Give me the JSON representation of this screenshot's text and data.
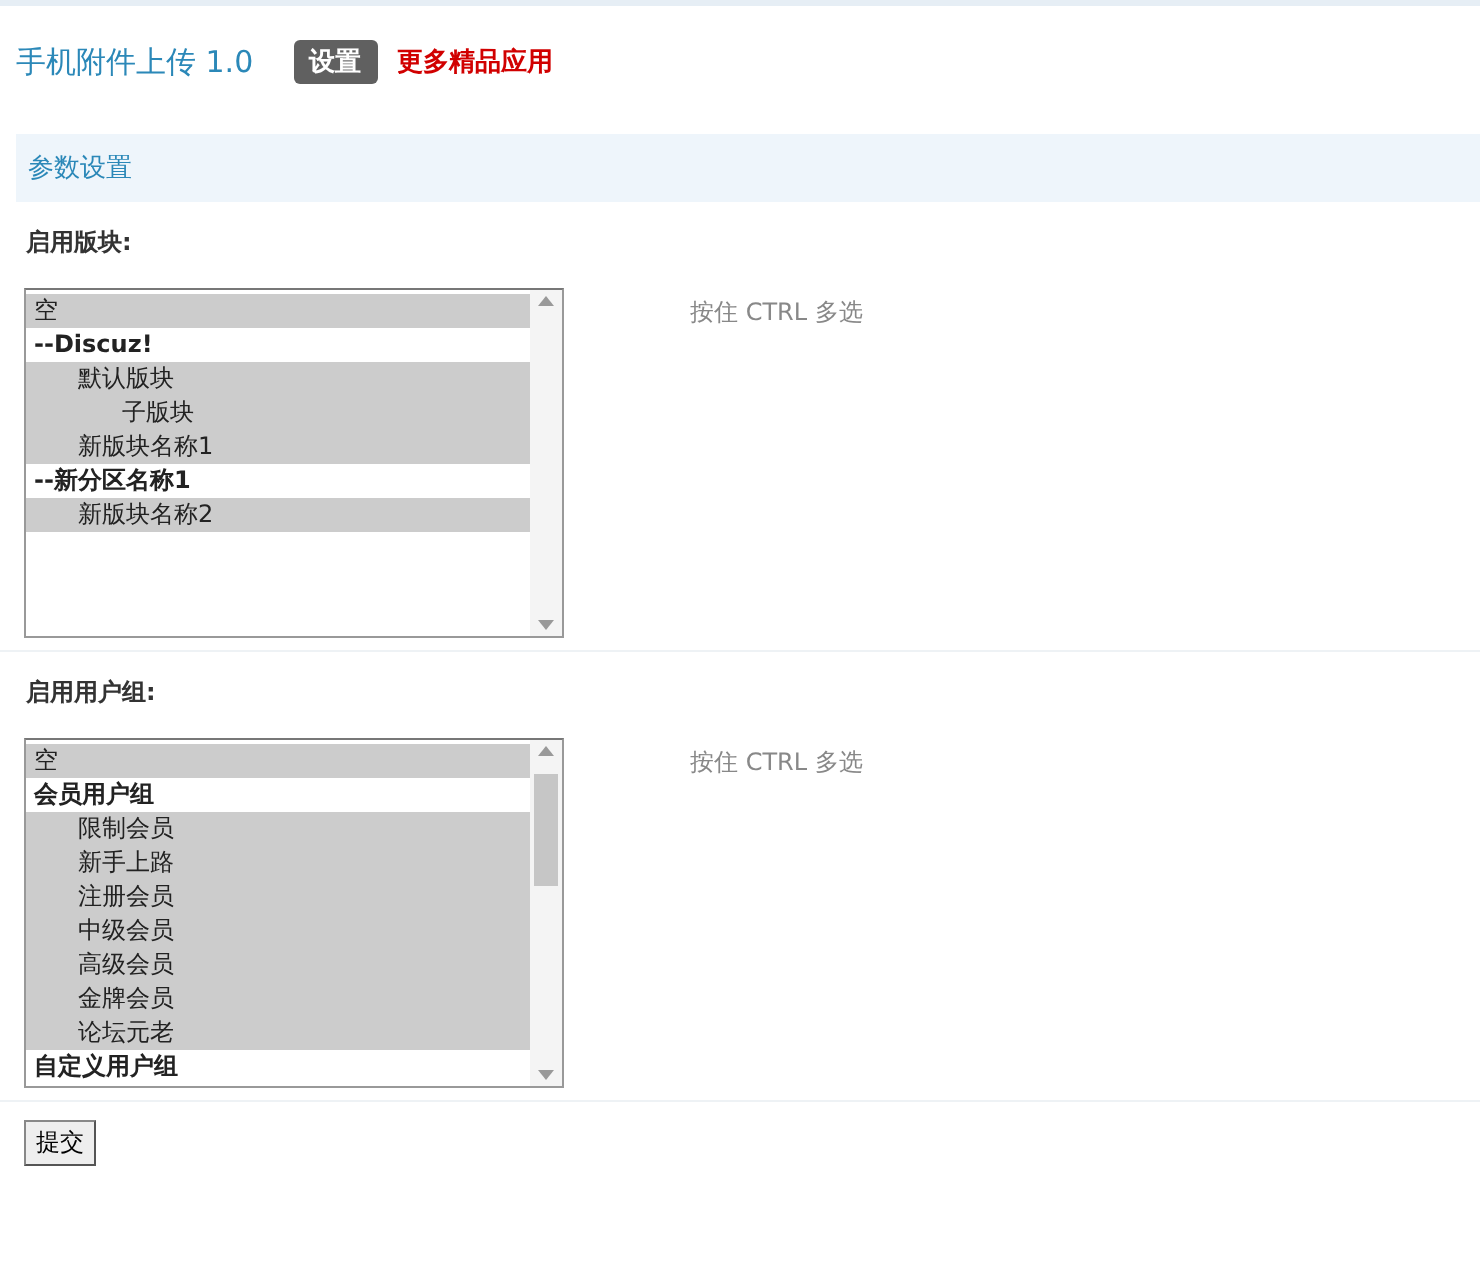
{
  "header": {
    "title": "手机附件上传 1.0",
    "tab": {
      "label": "设置",
      "selected": true
    },
    "link": "更多精品应用"
  },
  "section": {
    "title": "参数设置"
  },
  "fields": [
    {
      "label": "启用版块:",
      "hint": "按住 CTRL 多选",
      "options": [
        {
          "kind": "option",
          "label": "空",
          "selected": true
        },
        {
          "kind": "group",
          "label": "--Discuz!",
          "children": [
            {
              "kind": "option",
              "label": "默认版块",
              "selected": true,
              "children": [
                {
                  "kind": "option",
                  "label": "子版块",
                  "selected": true
                }
              ]
            },
            {
              "kind": "option",
              "label": "新版块名称1",
              "selected": true
            }
          ]
        },
        {
          "kind": "group",
          "label": "--新分区名称1",
          "children": [
            {
              "kind": "option",
              "label": "新版块名称2",
              "selected": true
            }
          ]
        }
      ]
    },
    {
      "label": "启用用户组:",
      "hint": "按住 CTRL 多选",
      "options": [
        {
          "kind": "option",
          "label": "空",
          "selected": true
        },
        {
          "kind": "group",
          "label": "会员用户组",
          "children": [
            {
              "kind": "option",
              "label": "限制会员",
              "selected": true
            },
            {
              "kind": "option",
              "label": "新手上路",
              "selected": true
            },
            {
              "kind": "option",
              "label": "注册会员",
              "selected": true
            },
            {
              "kind": "option",
              "label": "中级会员",
              "selected": true
            },
            {
              "kind": "option",
              "label": "高级会员",
              "selected": true
            },
            {
              "kind": "option",
              "label": "金牌会员",
              "selected": true
            },
            {
              "kind": "option",
              "label": "论坛元老",
              "selected": true
            }
          ]
        },
        {
          "kind": "group",
          "label": "自定义用户组"
        }
      ]
    }
  ],
  "submit": "提交"
}
